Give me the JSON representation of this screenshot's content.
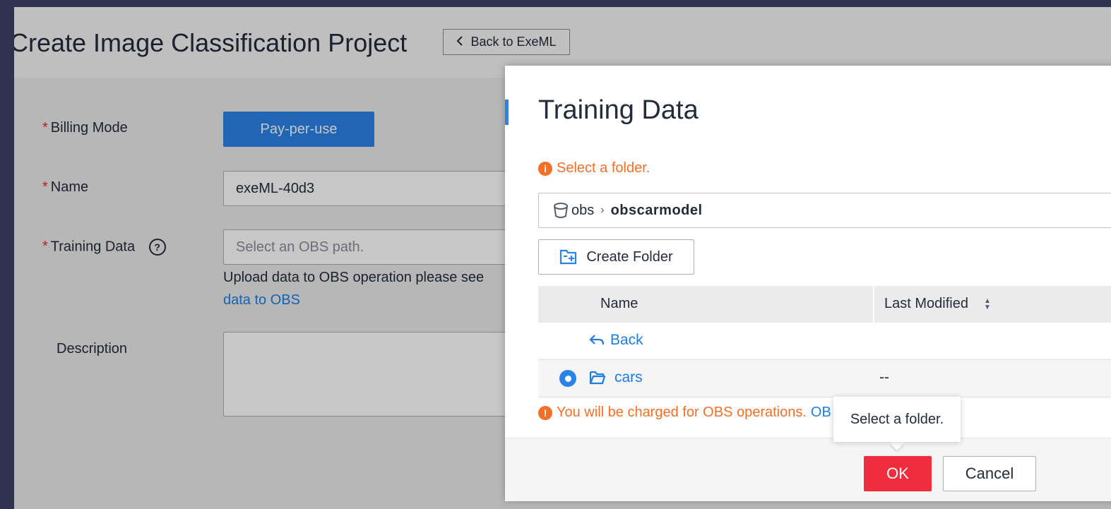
{
  "page": {
    "title": "Create Image Classification Project",
    "back_button": "Back to ExeML"
  },
  "form": {
    "billing_label": "Billing Mode",
    "billing_value": "Pay-per-use",
    "name_label": "Name",
    "name_value": "exeML-40d3",
    "training_label": "Training Data",
    "training_placeholder": "Select an OBS path.",
    "hint_text": "Upload data to OBS operation please see",
    "hint_link": "data to OBS",
    "description_label": "Description",
    "required_mark": "*"
  },
  "dialog": {
    "title": "Training Data",
    "info": "Select a folder.",
    "path_root": "obs",
    "path_current": "obscarmodel",
    "create_folder": "Create Folder",
    "columns": {
      "name": "Name",
      "modified": "Last Modified"
    },
    "back_label": "Back",
    "rows": [
      {
        "name": "cars",
        "modified": "--",
        "selected": true
      }
    ],
    "warning": "You will be charged for OBS operations.",
    "warning_link": "OB",
    "tooltip": "Select a folder.",
    "ok": "OK",
    "cancel": "Cancel"
  },
  "colors": {
    "primary": "#2983e8",
    "danger": "#f02c3f",
    "warning": "#f66f26",
    "link": "#1d7ee6"
  }
}
